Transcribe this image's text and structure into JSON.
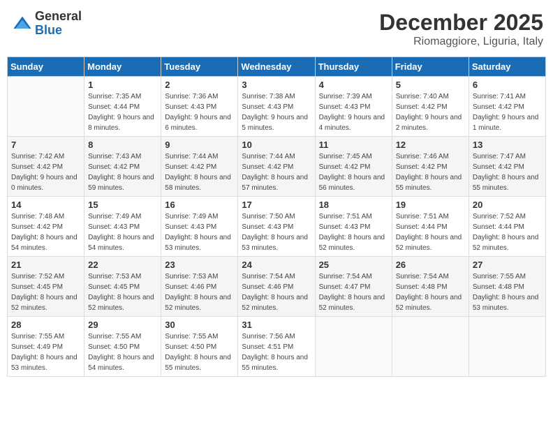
{
  "logo": {
    "general": "General",
    "blue": "Blue"
  },
  "header": {
    "month": "December 2025",
    "location": "Riomaggiore, Liguria, Italy"
  },
  "weekdays": [
    "Sunday",
    "Monday",
    "Tuesday",
    "Wednesday",
    "Thursday",
    "Friday",
    "Saturday"
  ],
  "weeks": [
    [
      {
        "day": "",
        "sunrise": "",
        "sunset": "",
        "daylight": ""
      },
      {
        "day": "1",
        "sunrise": "Sunrise: 7:35 AM",
        "sunset": "Sunset: 4:44 PM",
        "daylight": "Daylight: 9 hours and 8 minutes."
      },
      {
        "day": "2",
        "sunrise": "Sunrise: 7:36 AM",
        "sunset": "Sunset: 4:43 PM",
        "daylight": "Daylight: 9 hours and 6 minutes."
      },
      {
        "day": "3",
        "sunrise": "Sunrise: 7:38 AM",
        "sunset": "Sunset: 4:43 PM",
        "daylight": "Daylight: 9 hours and 5 minutes."
      },
      {
        "day": "4",
        "sunrise": "Sunrise: 7:39 AM",
        "sunset": "Sunset: 4:43 PM",
        "daylight": "Daylight: 9 hours and 4 minutes."
      },
      {
        "day": "5",
        "sunrise": "Sunrise: 7:40 AM",
        "sunset": "Sunset: 4:42 PM",
        "daylight": "Daylight: 9 hours and 2 minutes."
      },
      {
        "day": "6",
        "sunrise": "Sunrise: 7:41 AM",
        "sunset": "Sunset: 4:42 PM",
        "daylight": "Daylight: 9 hours and 1 minute."
      }
    ],
    [
      {
        "day": "7",
        "sunrise": "Sunrise: 7:42 AM",
        "sunset": "Sunset: 4:42 PM",
        "daylight": "Daylight: 9 hours and 0 minutes."
      },
      {
        "day": "8",
        "sunrise": "Sunrise: 7:43 AM",
        "sunset": "Sunset: 4:42 PM",
        "daylight": "Daylight: 8 hours and 59 minutes."
      },
      {
        "day": "9",
        "sunrise": "Sunrise: 7:44 AM",
        "sunset": "Sunset: 4:42 PM",
        "daylight": "Daylight: 8 hours and 58 minutes."
      },
      {
        "day": "10",
        "sunrise": "Sunrise: 7:44 AM",
        "sunset": "Sunset: 4:42 PM",
        "daylight": "Daylight: 8 hours and 57 minutes."
      },
      {
        "day": "11",
        "sunrise": "Sunrise: 7:45 AM",
        "sunset": "Sunset: 4:42 PM",
        "daylight": "Daylight: 8 hours and 56 minutes."
      },
      {
        "day": "12",
        "sunrise": "Sunrise: 7:46 AM",
        "sunset": "Sunset: 4:42 PM",
        "daylight": "Daylight: 8 hours and 55 minutes."
      },
      {
        "day": "13",
        "sunrise": "Sunrise: 7:47 AM",
        "sunset": "Sunset: 4:42 PM",
        "daylight": "Daylight: 8 hours and 55 minutes."
      }
    ],
    [
      {
        "day": "14",
        "sunrise": "Sunrise: 7:48 AM",
        "sunset": "Sunset: 4:42 PM",
        "daylight": "Daylight: 8 hours and 54 minutes."
      },
      {
        "day": "15",
        "sunrise": "Sunrise: 7:49 AM",
        "sunset": "Sunset: 4:43 PM",
        "daylight": "Daylight: 8 hours and 54 minutes."
      },
      {
        "day": "16",
        "sunrise": "Sunrise: 7:49 AM",
        "sunset": "Sunset: 4:43 PM",
        "daylight": "Daylight: 8 hours and 53 minutes."
      },
      {
        "day": "17",
        "sunrise": "Sunrise: 7:50 AM",
        "sunset": "Sunset: 4:43 PM",
        "daylight": "Daylight: 8 hours and 53 minutes."
      },
      {
        "day": "18",
        "sunrise": "Sunrise: 7:51 AM",
        "sunset": "Sunset: 4:43 PM",
        "daylight": "Daylight: 8 hours and 52 minutes."
      },
      {
        "day": "19",
        "sunrise": "Sunrise: 7:51 AM",
        "sunset": "Sunset: 4:44 PM",
        "daylight": "Daylight: 8 hours and 52 minutes."
      },
      {
        "day": "20",
        "sunrise": "Sunrise: 7:52 AM",
        "sunset": "Sunset: 4:44 PM",
        "daylight": "Daylight: 8 hours and 52 minutes."
      }
    ],
    [
      {
        "day": "21",
        "sunrise": "Sunrise: 7:52 AM",
        "sunset": "Sunset: 4:45 PM",
        "daylight": "Daylight: 8 hours and 52 minutes."
      },
      {
        "day": "22",
        "sunrise": "Sunrise: 7:53 AM",
        "sunset": "Sunset: 4:45 PM",
        "daylight": "Daylight: 8 hours and 52 minutes."
      },
      {
        "day": "23",
        "sunrise": "Sunrise: 7:53 AM",
        "sunset": "Sunset: 4:46 PM",
        "daylight": "Daylight: 8 hours and 52 minutes."
      },
      {
        "day": "24",
        "sunrise": "Sunrise: 7:54 AM",
        "sunset": "Sunset: 4:46 PM",
        "daylight": "Daylight: 8 hours and 52 minutes."
      },
      {
        "day": "25",
        "sunrise": "Sunrise: 7:54 AM",
        "sunset": "Sunset: 4:47 PM",
        "daylight": "Daylight: 8 hours and 52 minutes."
      },
      {
        "day": "26",
        "sunrise": "Sunrise: 7:54 AM",
        "sunset": "Sunset: 4:48 PM",
        "daylight": "Daylight: 8 hours and 52 minutes."
      },
      {
        "day": "27",
        "sunrise": "Sunrise: 7:55 AM",
        "sunset": "Sunset: 4:48 PM",
        "daylight": "Daylight: 8 hours and 53 minutes."
      }
    ],
    [
      {
        "day": "28",
        "sunrise": "Sunrise: 7:55 AM",
        "sunset": "Sunset: 4:49 PM",
        "daylight": "Daylight: 8 hours and 53 minutes."
      },
      {
        "day": "29",
        "sunrise": "Sunrise: 7:55 AM",
        "sunset": "Sunset: 4:50 PM",
        "daylight": "Daylight: 8 hours and 54 minutes."
      },
      {
        "day": "30",
        "sunrise": "Sunrise: 7:55 AM",
        "sunset": "Sunset: 4:50 PM",
        "daylight": "Daylight: 8 hours and 55 minutes."
      },
      {
        "day": "31",
        "sunrise": "Sunrise: 7:56 AM",
        "sunset": "Sunset: 4:51 PM",
        "daylight": "Daylight: 8 hours and 55 minutes."
      },
      {
        "day": "",
        "sunrise": "",
        "sunset": "",
        "daylight": ""
      },
      {
        "day": "",
        "sunrise": "",
        "sunset": "",
        "daylight": ""
      },
      {
        "day": "",
        "sunrise": "",
        "sunset": "",
        "daylight": ""
      }
    ]
  ]
}
